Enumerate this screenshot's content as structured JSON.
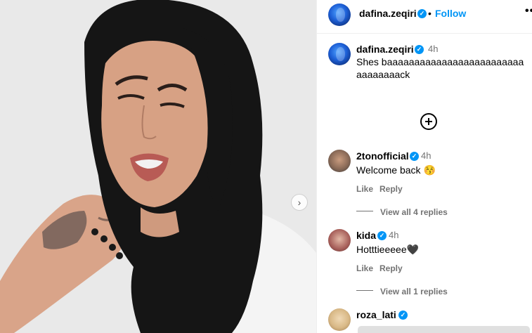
{
  "post": {
    "author": "dafina.zeqiri",
    "follow_label": "Follow",
    "separator": "•",
    "more_icon": "more-horizontal-icon",
    "verified_mark": "✓",
    "caption": {
      "username": "dafina.zeqiri",
      "time": "4h",
      "text": "Shes baaaaaaaaaaaaaaaaaaaaaaaaaaaaaaaaack"
    },
    "load_more_icon": "plus-circle-icon",
    "next_icon": "chevron-right-icon",
    "next_glyph": "›"
  },
  "comments": [
    {
      "username": "2tonofficial",
      "time": "4h",
      "text": "Welcome back 😚",
      "like_label": "Like",
      "reply_label": "Reply",
      "replies_label": "View all 4 replies"
    },
    {
      "username": "kida",
      "time": "4h",
      "text": "Hotttieeeee🖤",
      "like_label": "Like",
      "reply_label": "Reply",
      "replies_label": "View all 1 replies"
    },
    {
      "username": "roza_lati"
    }
  ],
  "colors": {
    "accent": "#0095f6",
    "secondary_text": "#737373",
    "divider": "#efefef"
  }
}
